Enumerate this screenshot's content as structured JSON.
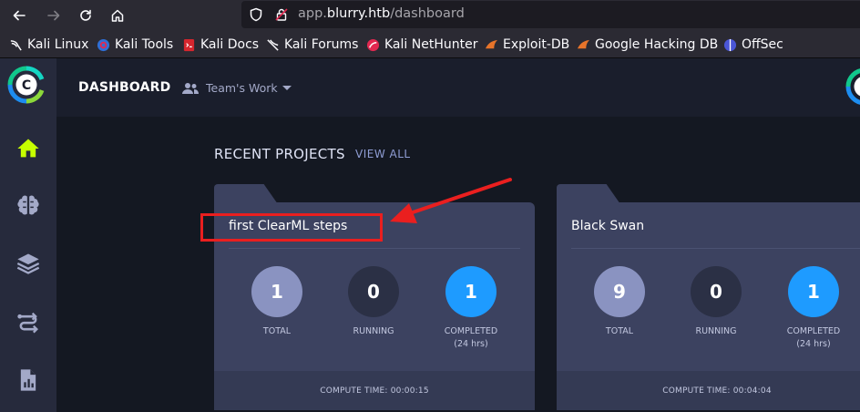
{
  "browser": {
    "url_prefix": "app.",
    "url_domain": "blurry.htb",
    "url_path": "/dashboard",
    "bookmarks": [
      {
        "label": "Kali Linux",
        "icon": "kali-dragon-icon"
      },
      {
        "label": "Kali Tools",
        "icon": "kali-tools-icon"
      },
      {
        "label": "Kali Docs",
        "icon": "kali-docs-icon"
      },
      {
        "label": "Kali Forums",
        "icon": "kali-forums-icon"
      },
      {
        "label": "Kali NetHunter",
        "icon": "nethunter-icon"
      },
      {
        "label": "Exploit-DB",
        "icon": "exploitdb-icon"
      },
      {
        "label": "Google Hacking DB",
        "icon": "ghdb-icon"
      },
      {
        "label": "OffSec",
        "icon": "offsec-icon"
      }
    ]
  },
  "app": {
    "accent": "#c6ff00",
    "topbar": {
      "title": "DASHBOARD",
      "workspace": "Team's Work"
    },
    "sidebar": [
      {
        "name": "home",
        "icon": "home-icon",
        "active": true
      },
      {
        "name": "models",
        "icon": "brain-icon",
        "active": false
      },
      {
        "name": "datasets",
        "icon": "layers-icon",
        "active": false
      },
      {
        "name": "pipelines",
        "icon": "pipelines-icon",
        "active": false
      },
      {
        "name": "reports",
        "icon": "report-icon",
        "active": false
      }
    ],
    "recent": {
      "title": "RECENT PROJECTS",
      "view_all": "VIEW ALL"
    },
    "projects": [
      {
        "name": "first ClearML steps",
        "total": "1",
        "running": "0",
        "completed": "1",
        "compute_time": "COMPUTE TIME: 00:00:15"
      },
      {
        "name": "Black Swan",
        "total": "9",
        "running": "0",
        "completed": "1",
        "compute_time": "COMPUTE TIME: 00:04:04"
      }
    ],
    "stat_labels": {
      "total": "TOTAL",
      "running": "RUNNING",
      "completed": "COMPLETED",
      "completed_sub": "(24 hrs)"
    }
  }
}
